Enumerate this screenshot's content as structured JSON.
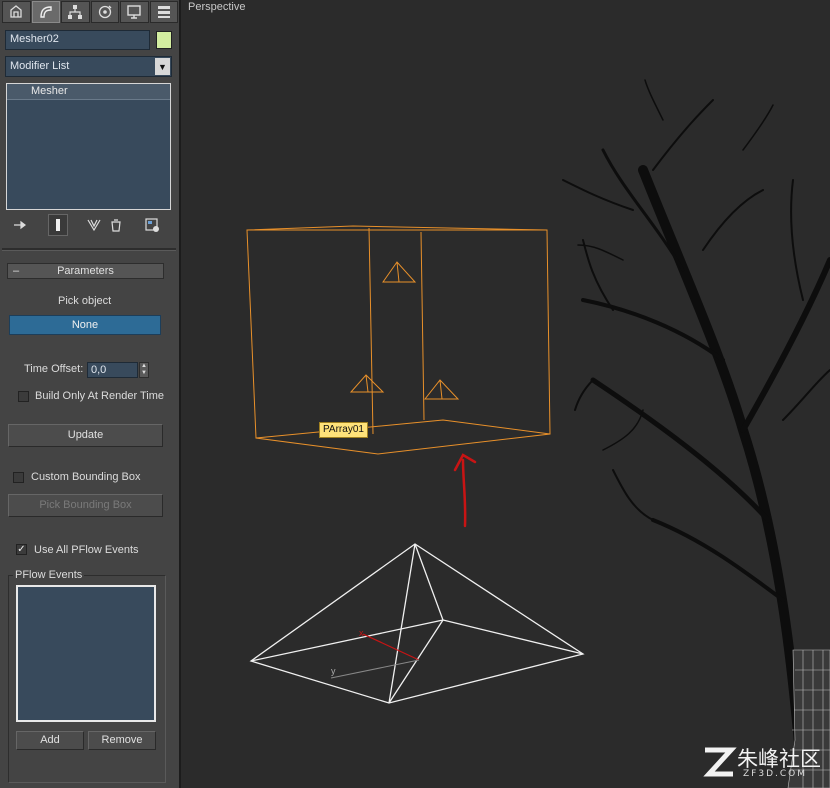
{
  "command_panel": {
    "tabs": [
      {
        "icon": "create-icon"
      },
      {
        "icon": "modify-icon"
      },
      {
        "icon": "hierarchy-icon"
      },
      {
        "icon": "motion-icon"
      },
      {
        "icon": "display-icon"
      },
      {
        "icon": "utilities-icon"
      }
    ],
    "active_tab": 1,
    "object_name": "Mesher02",
    "object_color": "#d4eea0",
    "modifier_list": "Modifier List",
    "stack": {
      "items": [
        "Mesher"
      ]
    },
    "parameters": {
      "rollout_toggle": "–",
      "rollout_title": "Parameters",
      "pick_object_label": "Pick object",
      "pick_object_value": "None",
      "time_offset_label": "Time Offset:",
      "time_offset_value": "0,0",
      "build_render_label": "Build Only At Render Time",
      "build_render_checked": false,
      "update_label": "Update",
      "custom_bbox_label": "Custom Bounding Box",
      "custom_bbox_checked": false,
      "pick_bbox_label": "Pick Bounding Box",
      "use_pflow_label": "Use All PFlow Events",
      "use_pflow_checked": true,
      "pflow_group_title": "PFlow Events",
      "pflow_events": [],
      "add_label": "Add",
      "remove_label": "Remove"
    }
  },
  "viewport": {
    "label": "Perspective",
    "selected_object_tag": "PArray01",
    "selection_color": "#e8902a",
    "axis_x_label": "x",
    "axis_y_label": "y"
  },
  "watermark": {
    "text": "朱峰社区",
    "subtext": "ZF3D.COM"
  }
}
